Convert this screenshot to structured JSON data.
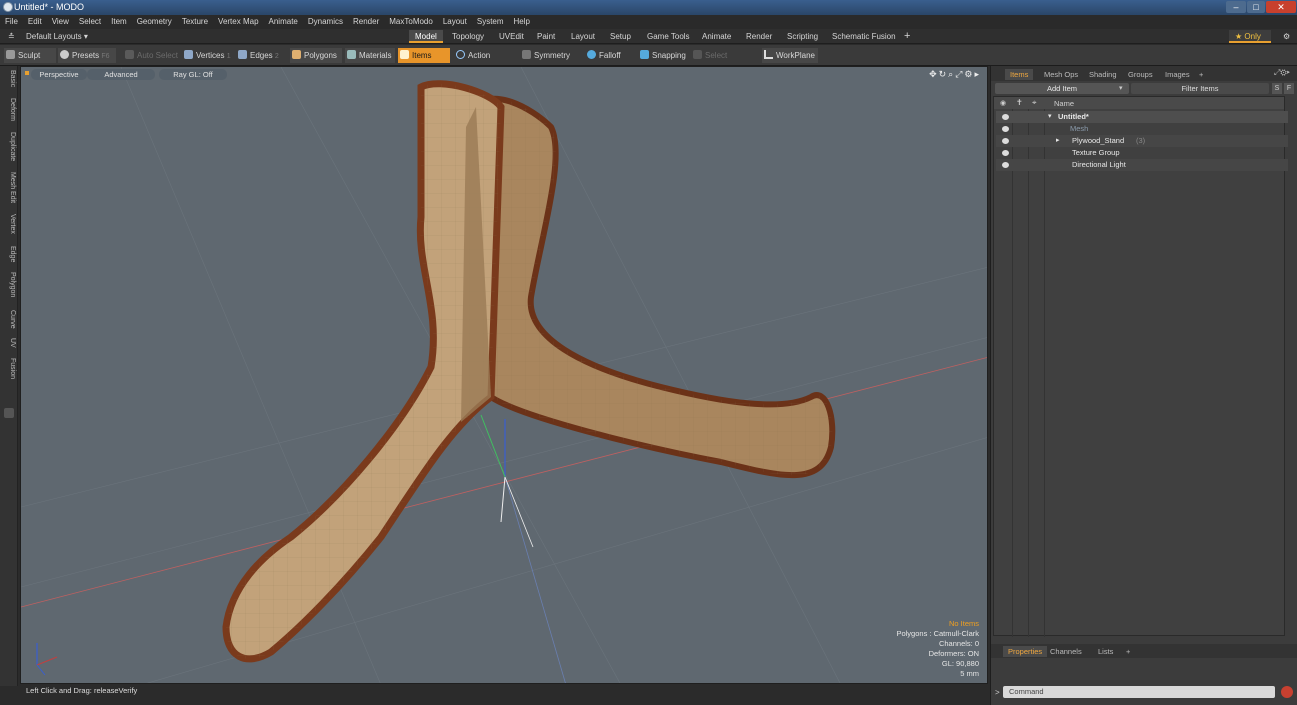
{
  "window": {
    "title": "Untitled* - MODO",
    "controls": {
      "minimize": "–",
      "maximize": "□",
      "close": "✕"
    }
  },
  "menu": [
    "File",
    "Edit",
    "View",
    "Select",
    "Item",
    "Geometry",
    "Texture",
    "Vertex Map",
    "Animate",
    "Dynamics",
    "Render",
    "MaxToModo",
    "Layout",
    "System",
    "Help"
  ],
  "layouts": {
    "selector": "Default Layouts ▾",
    "tabs": [
      "Model",
      "Topology",
      "UVEdit",
      "Paint",
      "Layout",
      "Setup",
      "Game Tools",
      "Animate",
      "Render",
      "Scripting",
      "Schematic Fusion"
    ],
    "active_tab": "Model",
    "add": "+",
    "only": "★  Only",
    "gear": "⚙"
  },
  "toolbar": {
    "sculpt": "Sculpt",
    "presets": "Presets",
    "presets_key": "F6",
    "auto_select": "Auto Select",
    "vertices": "Vertices",
    "vertices_num": "1",
    "edges": "Edges",
    "edges_num": "2",
    "polygons": "Polygons",
    "materials": "Materials",
    "items": "Items",
    "action_center": "Action Center",
    "symmetry": "Symmetry",
    "falloff": "Falloff",
    "snapping": "Snapping",
    "select_through": "Select Through",
    "workplane": "WorkPlane"
  },
  "left_tabs": [
    "Basic",
    "Deform",
    "Duplicate",
    "Mesh Edit",
    "Vertex",
    "Edge",
    "Polygon",
    "Curve",
    "UV",
    "Fusion"
  ],
  "viewport": {
    "view": "Perspective",
    "advanced": "Advanced",
    "raygl": "Ray GL: Off",
    "info": {
      "items": "No Items",
      "polygons": "Polygons : Catmull-Clark",
      "channels": "Channels: 0",
      "deformers": "Deformers: ON",
      "gl": "GL: 90,880",
      "scale": "5 mm"
    }
  },
  "status": {
    "hint": "Left Click and Drag:  releaseVerify"
  },
  "right_panel": {
    "tabs": [
      "Items",
      "Mesh Ops",
      "Shading",
      "Groups",
      "Images",
      "+"
    ],
    "active_tab": "Items",
    "add_item": "Add Item",
    "filter_items": "Filter Items",
    "s_btn": "S",
    "f_btn": "F",
    "column_name": "Name",
    "tree": [
      {
        "label": "Untitled*",
        "extra": "",
        "indent": 0,
        "style": "bold"
      },
      {
        "label": "Mesh",
        "extra": "",
        "indent": 1,
        "style": "dim"
      },
      {
        "label": "Plywood_Stand",
        "extra": "(3)",
        "indent": 1,
        "style": "normal"
      },
      {
        "label": "Texture Group",
        "extra": "",
        "indent": 1,
        "style": "normal"
      },
      {
        "label": "Directional Light",
        "extra": "",
        "indent": 1,
        "style": "normal"
      }
    ],
    "bottom_tabs": [
      "Properties",
      "Channels",
      "Lists",
      "+"
    ],
    "bottom_active": "Properties",
    "command_placeholder": "Command",
    "prompt": ">"
  },
  "colors": {
    "accent": "#e8952a",
    "viewport_bg": "#5f6870",
    "wood_face": "#b89a73",
    "wood_edge": "#7a3a1c"
  }
}
